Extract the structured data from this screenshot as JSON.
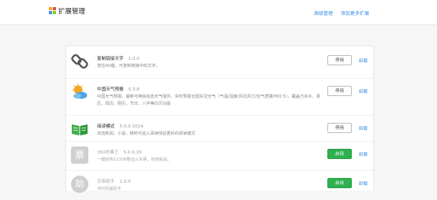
{
  "header": {
    "title": "扩展管理",
    "nav": [
      "高级管理",
      "添加更多扩展"
    ]
  },
  "extensions": [
    {
      "name": "复制链接文字",
      "version": "1.0.0",
      "description": "按住Alt键，可复制链接中的文字。",
      "action": "停用",
      "uninstall": "卸载",
      "enabled": true,
      "icon": "chain-link-icon"
    },
    {
      "name": "中国天气预报",
      "version": "5.3.8",
      "description": "中国天气预报，最新可换肤动态天气插件，实时预报全国实况天气（气温/湿度/风向风力/空气质量PM2.5），覆盖万余乡、县区，阳历，阴历，节日，八字等日历功能",
      "action": "停用",
      "uninstall": "卸载",
      "enabled": true,
      "icon": "weather-sun-cloud-icon"
    },
    {
      "name": "阅读模式",
      "version": "5.0.0.1014",
      "description": "浏览新闻、小说，随时可进入阅读体验更好的阅读模式",
      "action": "停用",
      "uninstall": "卸载",
      "enabled": true,
      "icon": "open-book-icon"
    },
    {
      "name": "360抢票王",
      "version": "5.0.0.15",
      "description": "一键抢购12306春运火车票，抢到就是。",
      "action": "启用",
      "uninstall": "卸载",
      "enabled": false,
      "icon": "ticket-icon",
      "icon_glyph": "票"
    },
    {
      "name": "页面助手",
      "version": "1.0.0",
      "description": "360页面助手",
      "action": "启用",
      "uninstall": "卸载",
      "enabled": false,
      "icon": "helper-icon",
      "icon_glyph": "助"
    }
  ],
  "colors": {
    "link": "#3b8ee6",
    "enable_button": "#2eb14f",
    "page_bg": "#f6f6f6"
  }
}
